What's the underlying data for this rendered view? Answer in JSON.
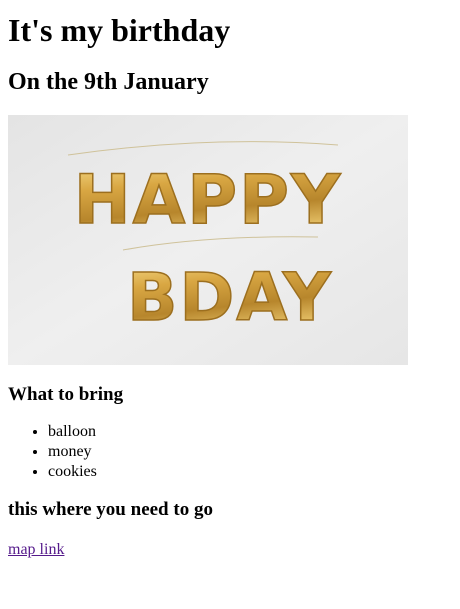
{
  "page": {
    "title": "It's my birthday",
    "subtitle": "On the 9th January",
    "image_text": {
      "line1": "HAPPY",
      "line2": "BDAY"
    },
    "bring_heading": "What to bring",
    "bring_items": [
      "balloon",
      "money",
      "cookies"
    ],
    "directions_heading": "this where you need to go",
    "map_link": "map link"
  },
  "colors": {
    "text": "#000000",
    "visited_link": "#551a8b",
    "image_background": "#ececec",
    "balloon_gold": "#d4a545"
  }
}
